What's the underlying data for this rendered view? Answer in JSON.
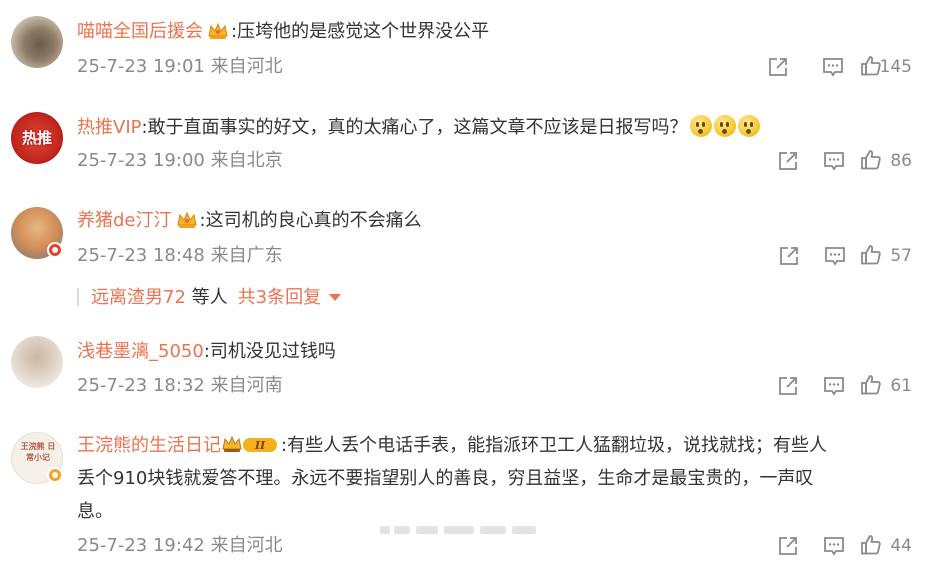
{
  "comments": [
    {
      "username": "喵喵全国后援会",
      "text": ":压垮他的是感觉这个世界没公平",
      "time": "25-7-23 19:01",
      "location": "来自河北",
      "likes": "145",
      "avatar_icon": "cat-photo-avatar",
      "badge_icon": "crown-icon"
    },
    {
      "username": "热推VIP",
      "text": ":敢于直面事实的好文，真的太痛心了，这篇文章不应该是日报写吗？",
      "time": "25-7-23 19:00",
      "location": "来自北京",
      "likes": "86",
      "avatar_text": "热推",
      "emoji_icons": [
        "doge-face-emoji",
        "doge-face-emoji",
        "doge-face-emoji"
      ]
    },
    {
      "username": "养猪de汀汀",
      "text": ":这司机的良心真的不会痛么",
      "time": "25-7-23 18:48",
      "location": "来自广东",
      "likes": "57",
      "avatar_icon": "cat-photo-avatar",
      "badge_icon": "crown-icon"
    },
    {
      "username": "浅巷墨漓_5050",
      "text": ":司机没见过钱吗",
      "time": "25-7-23 18:32",
      "location": "来自河南",
      "likes": "61",
      "avatar_icon": "girl-photo-avatar"
    },
    {
      "username": "王浣熊的生活日记",
      "text_lines": [
        ":有些人丢个电话手表，能指派环卫工人猛翻垃圾，说找就找；有些人",
        "丢个910块钱就爱答不理。永远不要指望别人的善良，穷且益坚，生命才是最宝贵的，一声叹",
        "息。"
      ],
      "time": "25-7-23 19:42",
      "location": "来自河北",
      "likes": "44",
      "avatar_text": "王浣熊 日常小记",
      "badge_icon": "crown-level-2-icon"
    }
  ],
  "reply_bar": {
    "name": "远离渣男72",
    "suffix": "等人",
    "count_label": "共3条回复",
    "caret_icon": "caret-down-icon"
  },
  "action_icons": [
    "share-icon",
    "comment-icon",
    "like-icon"
  ],
  "colors": {
    "username": "#eb7350",
    "meta": "#8a8a8a",
    "text": "#333333",
    "icon": "#8a8a8a"
  }
}
